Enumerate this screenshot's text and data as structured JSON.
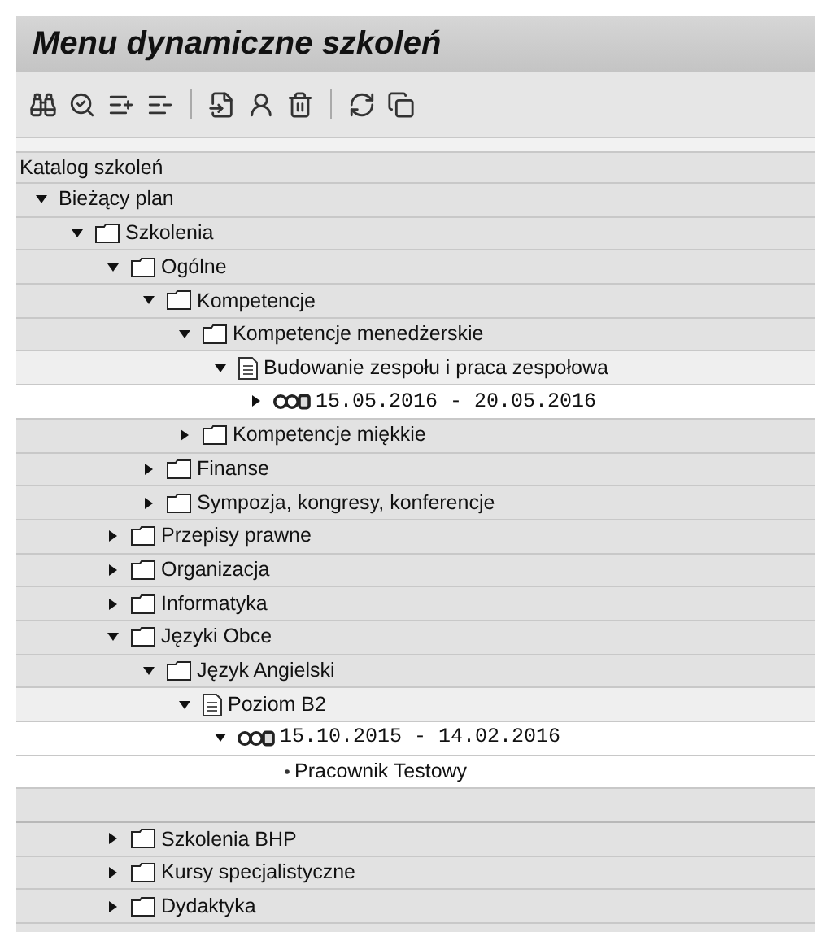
{
  "window": {
    "title": "Menu dynamiczne szkoleń"
  },
  "tree": {
    "header": "Katalog szkoleń",
    "items": [
      {
        "label": "Bieżący plan",
        "expanded": true,
        "children": [
          {
            "kind": "folder",
            "label": "Szkolenia",
            "expanded": true,
            "children": [
              {
                "kind": "folder",
                "label": "Ogólne",
                "expanded": true,
                "children": [
                  {
                    "kind": "folder",
                    "label": "Kompetencje",
                    "expanded": true,
                    "children": [
                      {
                        "kind": "folder",
                        "label": "Kompetencje menedżerskie",
                        "expanded": true,
                        "children": [
                          {
                            "kind": "document",
                            "label": "Budowanie zespołu i praca zespołowa",
                            "expanded": true,
                            "children": [
                              {
                                "kind": "date",
                                "label": "15.05.2016 - 20.05.2016",
                                "expanded": false
                              }
                            ]
                          }
                        ]
                      },
                      {
                        "kind": "folder",
                        "label": "Kompetencje miękkie",
                        "expanded": false
                      }
                    ]
                  },
                  {
                    "kind": "folder",
                    "label": "Finanse",
                    "expanded": false
                  },
                  {
                    "kind": "folder",
                    "label": "Sympozja, kongresy, konferencje",
                    "expanded": false
                  }
                ]
              },
              {
                "kind": "folder",
                "label": "Przepisy prawne",
                "expanded": false
              },
              {
                "kind": "folder",
                "label": "Organizacja",
                "expanded": false
              },
              {
                "kind": "folder",
                "label": "Informatyka",
                "expanded": false
              },
              {
                "kind": "folder",
                "label": "Języki Obce",
                "expanded": true,
                "children": [
                  {
                    "kind": "folder",
                    "label": "Język Angielski",
                    "expanded": true,
                    "children": [
                      {
                        "kind": "document",
                        "label": "Poziom B2",
                        "expanded": true,
                        "children": [
                          {
                            "kind": "date",
                            "label": "15.10.2015 - 14.02.2016",
                            "expanded": true,
                            "children": [
                              {
                                "kind": "person",
                                "label": "Pracownik Testowy"
                              }
                            ]
                          }
                        ]
                      }
                    ]
                  }
                ]
              },
              {
                "kind": "folder",
                "label": "Szkolenia BHP",
                "expanded": false
              },
              {
                "kind": "folder",
                "label": "Kursy specjalistyczne",
                "expanded": false
              },
              {
                "kind": "folder",
                "label": "Dydaktyka",
                "expanded": false
              }
            ]
          }
        ]
      }
    ]
  }
}
